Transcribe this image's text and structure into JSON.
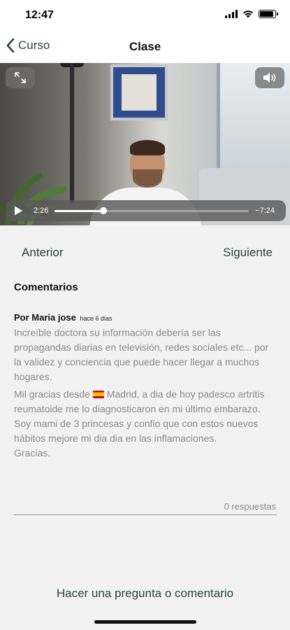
{
  "status_bar": {
    "time": "12:47",
    "battery_level": 0.9,
    "signal_bars": 4
  },
  "nav": {
    "back_label": "Curso",
    "title": "Clase"
  },
  "player": {
    "elapsed": "2:26",
    "remaining": "−7:24",
    "progress": 0.25
  },
  "lesson_nav": {
    "previous_label": "Anterior",
    "next_label": "Siguiente"
  },
  "comments": {
    "heading": "Comentarios",
    "items": [
      {
        "author_prefix": "Por",
        "author": "Maria jose",
        "date": "hace 6 dias",
        "paragraph1": "Increíble doctora su información debería ser las propagandas diarias en televisión, redes sociales etc... por la validez y conciencia que puede hacer llegar a muchos hogares.",
        "paragraph2_before_flag": "Mil gracias desde",
        "paragraph2_after_flag": "Madrid, a dia de hoy padesco artritis reumatoide me lo diagnosticaron en mi último embarazo.",
        "paragraph3": "Soy mami de 3 princesas y confio que con estos nuevos hábitos mejore mi dia dia en las inflamaciones.",
        "paragraph4": "Gracias.",
        "replies": "0 respuestas"
      }
    ]
  },
  "footer": {
    "ask_label": "Hacer una pregunta o comentario"
  },
  "colors": {
    "accent": "#24493a",
    "background": "#f2f2f2",
    "muted_text": "#8a8a8a"
  }
}
